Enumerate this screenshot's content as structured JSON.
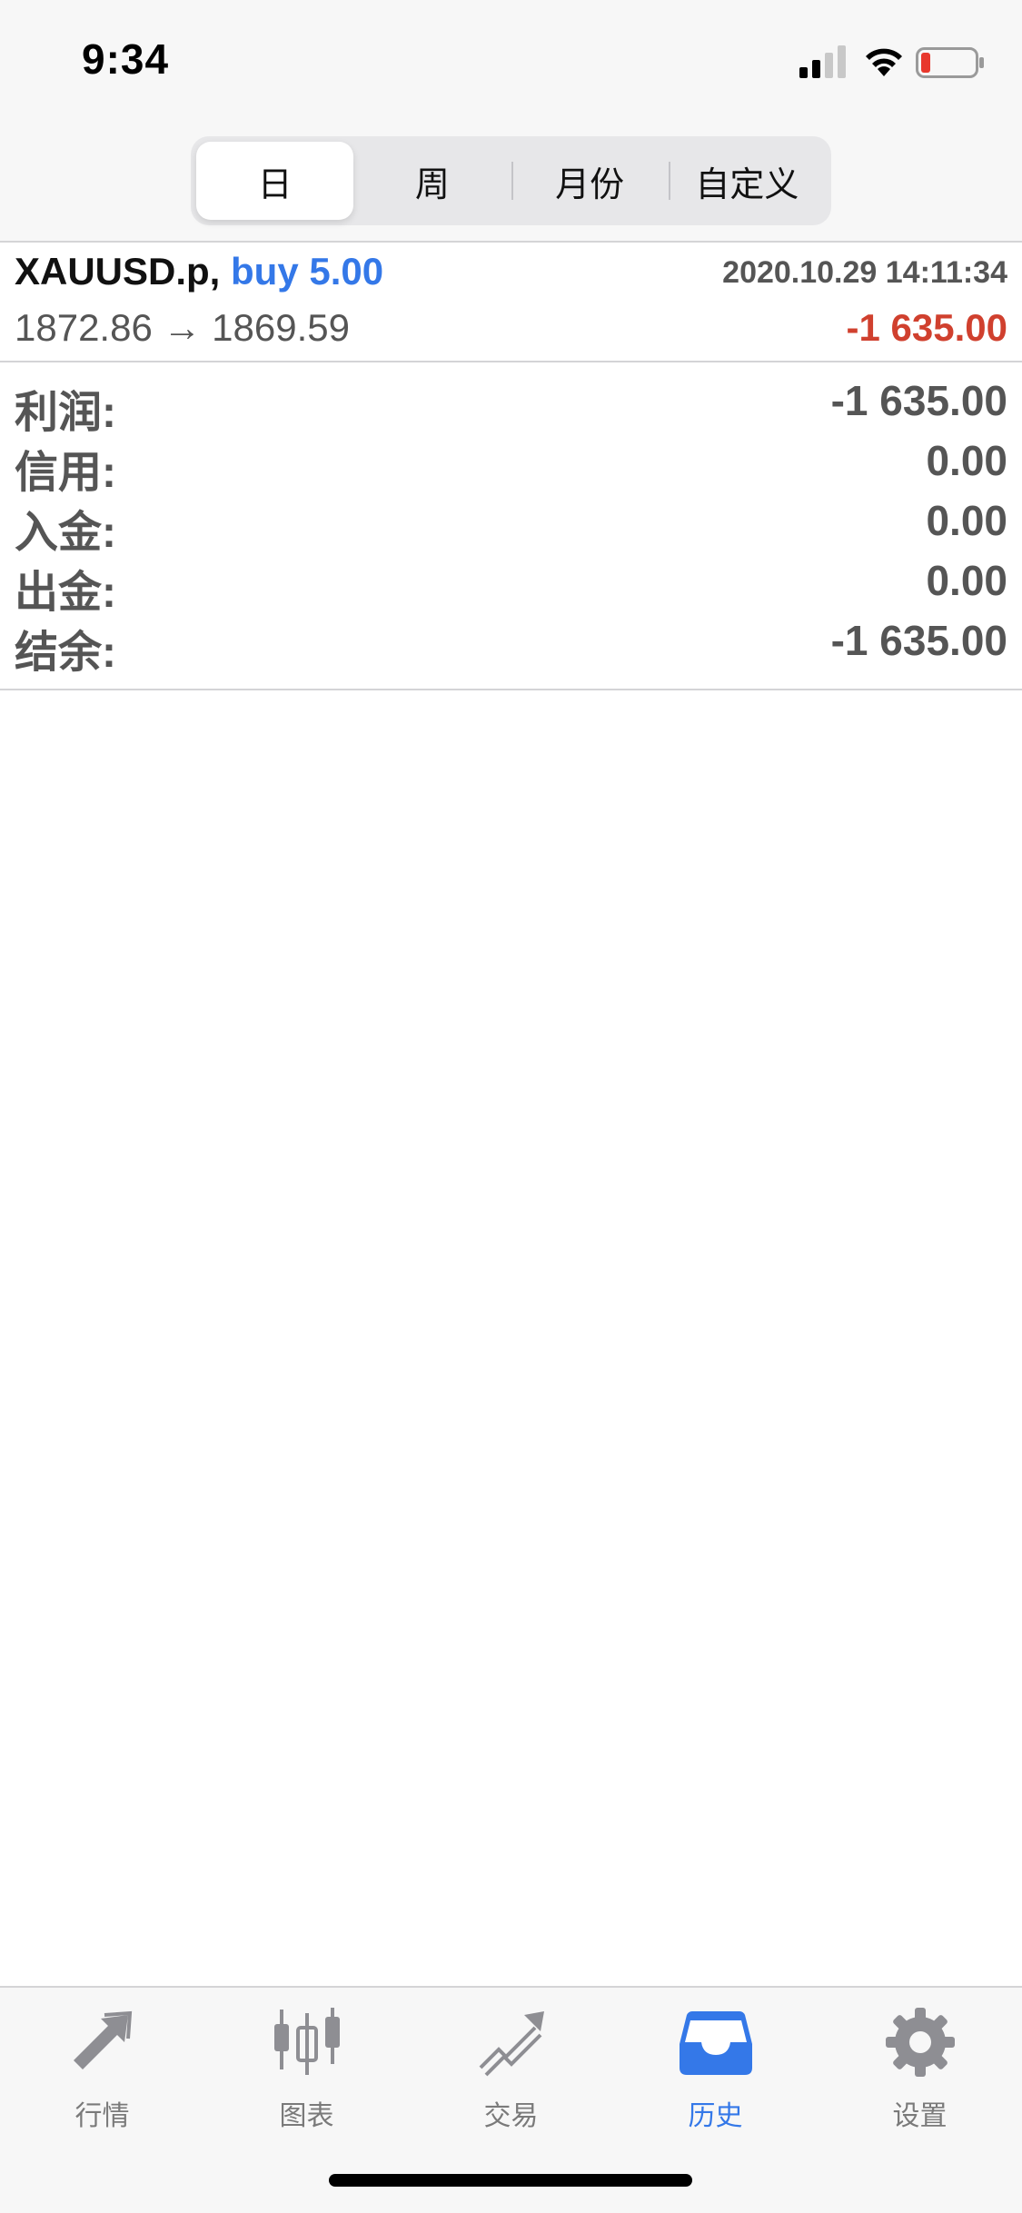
{
  "status_bar": {
    "time": "9:34"
  },
  "segments": [
    {
      "label": "日",
      "active": true
    },
    {
      "label": "周",
      "active": false
    },
    {
      "label": "月份",
      "active": false
    },
    {
      "label": "自定义",
      "active": false
    }
  ],
  "deal": {
    "symbol": "XAUUSD.p,",
    "type_volume": "buy 5.00",
    "time": "2020.10.29 14:11:34",
    "prices": "1872.86 → 1869.59",
    "profit": "-1 635.00"
  },
  "summary": [
    {
      "label": "利润:",
      "value": "-1 635.00"
    },
    {
      "label": "信用:",
      "value": "0.00"
    },
    {
      "label": "入金:",
      "value": "0.00"
    },
    {
      "label": "出金:",
      "value": "0.00"
    },
    {
      "label": "结余:",
      "value": "-1 635.00"
    }
  ],
  "tabs": [
    {
      "label": "行情",
      "icon": "quotes-icon",
      "active": false
    },
    {
      "label": "图表",
      "icon": "chart-icon",
      "active": false
    },
    {
      "label": "交易",
      "icon": "trade-icon",
      "active": false
    },
    {
      "label": "历史",
      "icon": "history-icon",
      "active": true
    },
    {
      "label": "设置",
      "icon": "settings-icon",
      "active": false
    }
  ],
  "colors": {
    "accent": "#3478e8",
    "loss": "#d0402e",
    "muted": "#7a7a7a"
  }
}
